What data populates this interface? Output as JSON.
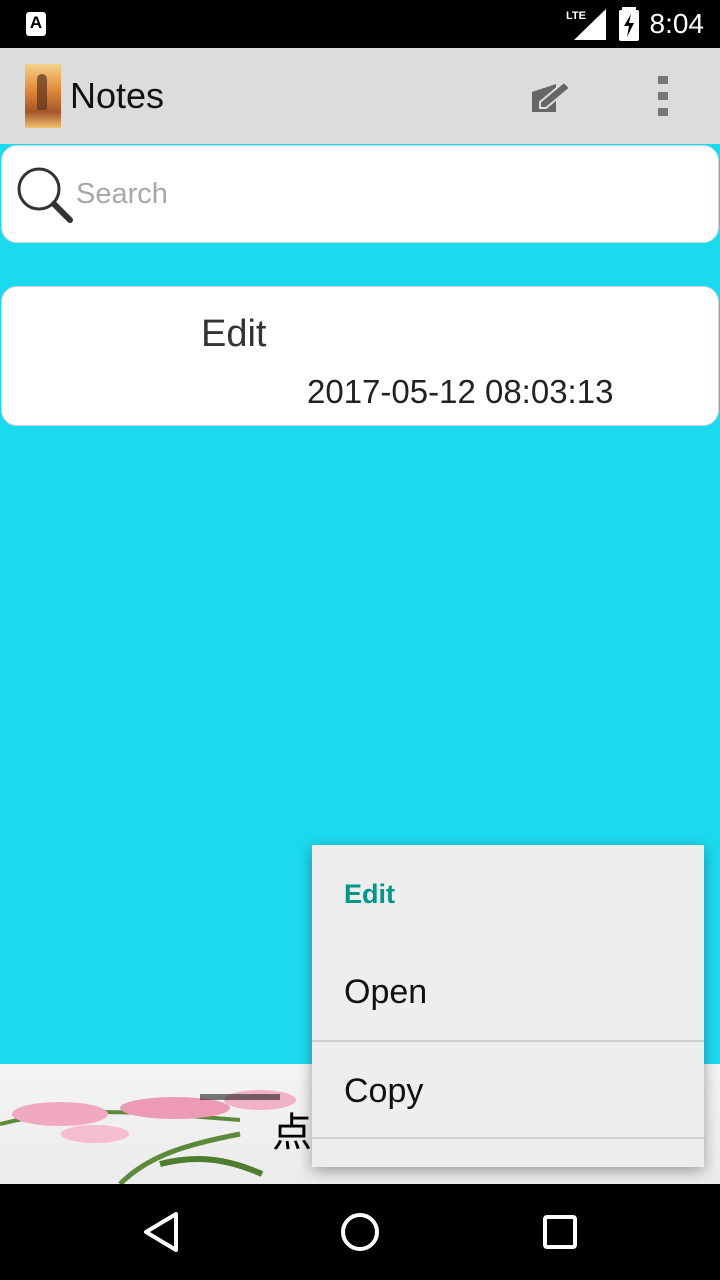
{
  "status_bar": {
    "app_icon_glyph": "A",
    "network": "LTE",
    "time": "8:04"
  },
  "action_bar": {
    "title": "Notes",
    "icons": [
      "app-logo-icon",
      "compose-icon",
      "overflow-menu-icon"
    ]
  },
  "search": {
    "placeholder": "Search",
    "value": ""
  },
  "notes": [
    {
      "title": "Edit",
      "date": "2017-05-12 08:03:13"
    }
  ],
  "banner": {
    "text": "点"
  },
  "context_menu": {
    "title": "Edit",
    "items": [
      "Open",
      "Copy"
    ]
  },
  "colors": {
    "background": "#1cdaee",
    "action_bar": "#dcdcdc",
    "menu_title": "#009688"
  }
}
